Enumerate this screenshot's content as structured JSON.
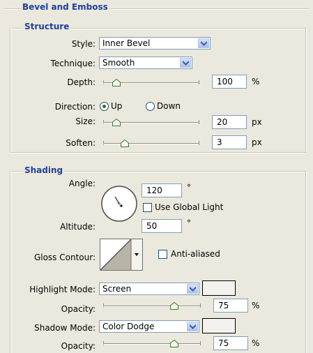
{
  "bevel": {
    "title": "Bevel and Emboss"
  },
  "structure": {
    "title": "Structure",
    "style_label": "Style:",
    "style_value": "Inner Bevel",
    "technique_label": "Technique:",
    "technique_value": "Smooth",
    "depth_label": "Depth:",
    "depth_value": "100",
    "depth_unit": "%",
    "depth_fraction": 0.1,
    "direction_label": "Direction:",
    "direction_up": "Up",
    "direction_down": "Down",
    "direction_selected": "Up",
    "size_label": "Size:",
    "size_value": "20",
    "size_unit": "px",
    "size_fraction": 0.1,
    "soften_label": "Soften:",
    "soften_value": "3",
    "soften_unit": "px",
    "soften_fraction": 0.2
  },
  "shading": {
    "title": "Shading",
    "angle_label": "Angle:",
    "angle_value": "120",
    "degree": "°",
    "use_global_light": "Use Global Light",
    "use_global_light_checked": false,
    "altitude_label": "Altitude:",
    "altitude_value": "50",
    "gloss_label": "Gloss Contour:",
    "anti_aliased": "Anti-aliased",
    "anti_aliased_checked": false,
    "highlight_mode_label": "Highlight Mode:",
    "highlight_mode_value": "Screen",
    "highlight_opacity_label": "Opacity:",
    "highlight_opacity_value": "75",
    "highlight_opacity_unit": "%",
    "highlight_opacity_fraction": 0.75,
    "shadow_mode_label": "Shadow Mode:",
    "shadow_mode_value": "Color Dodge",
    "shadow_opacity_label": "Opacity:",
    "shadow_opacity_value": "75",
    "shadow_opacity_unit": "%",
    "shadow_opacity_fraction": 0.75
  },
  "colors": {
    "group_title": "#1f3f9e",
    "input_border": "#7f9db9",
    "background": "#ebe9dd",
    "highlight_swatch": "#f4f2ee",
    "shadow_swatch": "#f4f2ee"
  },
  "icons": {
    "dropdown": "chevron-down-icon",
    "slider": "slider-thumb-icon",
    "angle": "angle-dial-icon",
    "gloss": "contour-preview-icon"
  }
}
